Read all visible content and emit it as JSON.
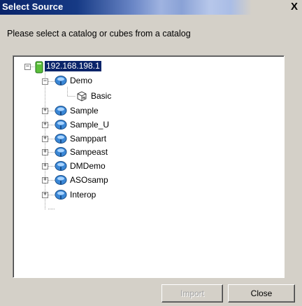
{
  "window": {
    "title": "Select Source",
    "close_glyph": "X"
  },
  "instruction": "Please select a catalog or cubes from a catalog",
  "tree": {
    "server": {
      "label": "192.168.198.1",
      "expander": "−",
      "icon": "server-icon"
    },
    "catalogs": [
      {
        "label": "Demo",
        "expander": "−",
        "icon": "catalog-icon",
        "expanded": true,
        "children": [
          {
            "label": "Basic",
            "icon": "cube-icon"
          }
        ]
      },
      {
        "label": "Sample",
        "expander": "+",
        "icon": "catalog-icon"
      },
      {
        "label": "Sample_U",
        "expander": "+",
        "icon": "catalog-icon"
      },
      {
        "label": "Samppart",
        "expander": "+",
        "icon": "catalog-icon"
      },
      {
        "label": "Sampeast",
        "expander": "+",
        "icon": "catalog-icon"
      },
      {
        "label": "DMDemo",
        "expander": "+",
        "icon": "catalog-icon"
      },
      {
        "label": "ASOsamp",
        "expander": "+",
        "icon": "catalog-icon"
      },
      {
        "label": "Interop",
        "expander": "+",
        "icon": "catalog-icon"
      }
    ]
  },
  "buttons": {
    "import_label": "Import",
    "close_label": "Close"
  },
  "colors": {
    "title_bar": "#0a246a",
    "selection": "#0a246a",
    "dialog_bg": "#d4d0c8"
  }
}
